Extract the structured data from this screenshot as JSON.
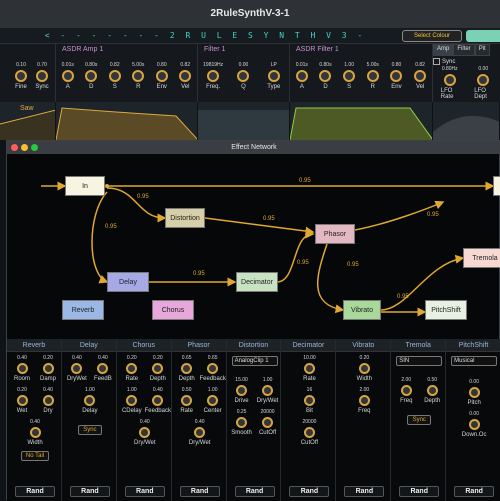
{
  "host_title": "2RuleSynthV-3-1",
  "logo": "< - - - - - - - 2 R U L E S Y N T H  V 3 - - - - - - - >",
  "select_colour": "Select Colour",
  "osc": {
    "knobs": [
      {
        "v": "0.10",
        "l": "Fine"
      },
      {
        "v": "0.70",
        "l": "Sync"
      }
    ]
  },
  "amp": {
    "title": "ASDR Amp 1",
    "knobs": [
      {
        "v": "0.01s",
        "l": "A"
      },
      {
        "v": "0.80s",
        "l": "D"
      },
      {
        "v": "0.82",
        "l": "S"
      },
      {
        "v": "5.00s",
        "l": "R"
      },
      {
        "v": "0.80",
        "l": "Env"
      },
      {
        "v": "0.82",
        "l": "Vel"
      }
    ]
  },
  "filter": {
    "title": "Filter 1",
    "knobs": [
      {
        "v": "19819Hz",
        "l": "Freq."
      },
      {
        "v": "0.00",
        "l": "Q"
      },
      {
        "v": "LP",
        "l": "Type"
      }
    ]
  },
  "filteradsr": {
    "title": "ASDR Filter 1",
    "knobs": [
      {
        "v": "0.01s",
        "l": "A"
      },
      {
        "v": "0.80s",
        "l": "D"
      },
      {
        "v": "1.00",
        "l": "S"
      },
      {
        "v": "5.00s",
        "l": "R"
      },
      {
        "v": "0.80",
        "l": "Env"
      },
      {
        "v": "0.82",
        "l": "Vel"
      }
    ]
  },
  "lfo": {
    "tabs": [
      "Amp",
      "Filter",
      "Pit"
    ],
    "sync": "Sync",
    "knobs": [
      {
        "v": "0.80Hz",
        "l": "LFO Rate"
      },
      {
        "v": "0.00",
        "l": "LFO Dept"
      }
    ]
  },
  "saw_label": "Saw",
  "window_title": "Effect Network",
  "nodes": {
    "in": "In",
    "distortion": "Distortion",
    "phasor": "Phasor",
    "delay": "Delay",
    "decimator": "Decimator",
    "tremola": "Tremola",
    "reverb": "Reverb",
    "chorus": "Chorus",
    "vibrato": "Vibrato",
    "pitchshift": "PitchShift"
  },
  "conns": [
    "0.95",
    "0.95",
    "0.95",
    "0.95",
    "0.95",
    "0.95",
    "0.95",
    "0.95",
    "0.95",
    "0.95"
  ],
  "panels": {
    "reverb": {
      "title": "Reverb",
      "k": [
        {
          "v": "0.40",
          "l": "Room"
        },
        {
          "v": "0.20",
          "l": "Damp"
        },
        {
          "v": "0.20",
          "l": "Wet"
        },
        {
          "v": "0.40",
          "l": "Dry"
        },
        {
          "v": "0.40",
          "l": "Width"
        }
      ],
      "btn": "No Tail",
      "rand": "Rand"
    },
    "delay": {
      "title": "Delay",
      "k": [
        {
          "v": "0.40",
          "l": "DryWet"
        },
        {
          "v": "0.40",
          "l": "FeedB"
        },
        {
          "v": "1.00",
          "l": "Delay"
        }
      ],
      "btn": "Sync",
      "rand": "Rand"
    },
    "chorus": {
      "title": "Chorus",
      "k": [
        {
          "v": "0.20",
          "l": "Rate"
        },
        {
          "v": "0.20",
          "l": "Depth"
        },
        {
          "v": "1.00",
          "l": "CDelay"
        },
        {
          "v": "0.40",
          "l": "Feedback"
        },
        {
          "v": "0.40",
          "l": "Dry/Wet"
        }
      ],
      "rand": "Rand"
    },
    "phasor": {
      "title": "Phasor",
      "k": [
        {
          "v": "0.65",
          "l": "Depth"
        },
        {
          "v": "0.65",
          "l": "Feedback"
        },
        {
          "v": "0.50",
          "l": "Rate"
        },
        {
          "v": "1.00",
          "l": "Center"
        },
        {
          "v": "0.40",
          "l": "Dry/Wet"
        }
      ],
      "rand": "Rand"
    },
    "distortion": {
      "title": "Distortion",
      "drop": "AnalogClip 1",
      "k": [
        {
          "v": "15.00",
          "l": "Drive"
        },
        {
          "v": "1.00",
          "l": "Dry/Wet"
        },
        {
          "v": "0.25",
          "l": "Smooth"
        },
        {
          "v": "20000",
          "l": "CutOff"
        }
      ],
      "rand": "Rand"
    },
    "decimator": {
      "title": "Decimator",
      "k": [
        {
          "v": "10.00",
          "l": "Rate"
        },
        {
          "v": "16",
          "l": "Bit"
        },
        {
          "v": "20000",
          "l": "CutOff"
        }
      ],
      "rand": "Rand"
    },
    "vibrato": {
      "title": "Vibrato",
      "k": [
        {
          "v": "0.20",
          "l": "Width"
        },
        {
          "v": "2.00",
          "l": "Freq"
        }
      ],
      "rand": "Rand"
    },
    "tremola": {
      "title": "Tremola",
      "drop": "SIN",
      "k": [
        {
          "v": "2.00",
          "l": "Freq"
        },
        {
          "v": "0.50",
          "l": "Depth"
        }
      ],
      "btn": "Sync",
      "rand": "Rand"
    },
    "pitchshift": {
      "title": "PitchShift",
      "drop": "Musical",
      "k": [
        {
          "v": "0.00",
          "l": "Pitch"
        },
        {
          "v": "0.00",
          "l": "Down.Oc"
        }
      ],
      "rand": "Rand"
    }
  }
}
